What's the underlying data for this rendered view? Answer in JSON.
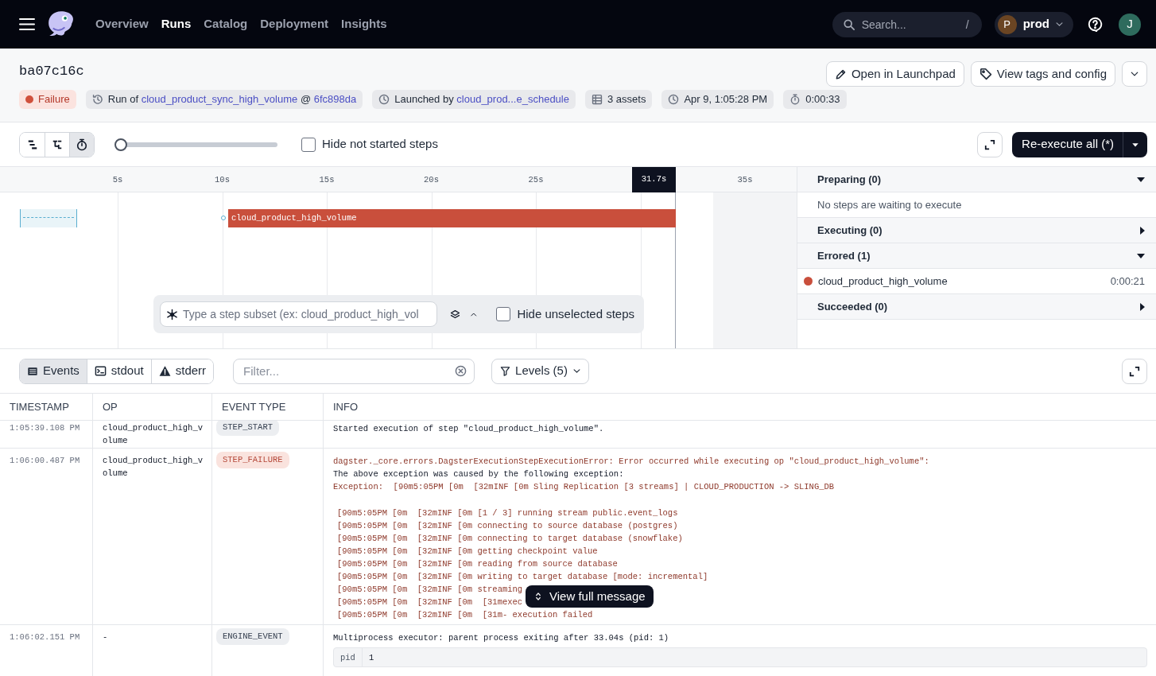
{
  "nav": {
    "links": [
      {
        "label": "Overview",
        "selected": false
      },
      {
        "label": "Runs",
        "selected": true
      },
      {
        "label": "Catalog",
        "selected": false
      },
      {
        "label": "Deployment",
        "selected": false
      },
      {
        "label": "Insights",
        "selected": false
      }
    ],
    "search": {
      "placeholder": "Search...",
      "shortcut": "/"
    },
    "deployment": {
      "initial": "P",
      "name": "prod"
    },
    "user": {
      "initial": "J"
    }
  },
  "run": {
    "title": "ba07c16c",
    "status": {
      "label": "Failure",
      "kind": "failure"
    },
    "tags": [
      {
        "kind": "job",
        "segments": [
          {
            "text": "Run of",
            "link": false
          },
          {
            "text": "cloud_product_sync_high_volume",
            "link": true
          },
          {
            "text": "@",
            "link": false
          },
          {
            "text": "6fc898da",
            "link": true
          }
        ]
      },
      {
        "kind": "launch",
        "segments": [
          {
            "text": "Launched by",
            "link": false
          },
          {
            "text": "cloud_prod...e_schedule",
            "link": true
          }
        ]
      },
      {
        "kind": "assets",
        "segments": [
          {
            "text": "3 assets",
            "link": false
          }
        ]
      },
      {
        "kind": "start",
        "segments": [
          {
            "text": "Apr 9, 1:05:28 PM",
            "link": false
          }
        ]
      },
      {
        "kind": "duration",
        "segments": [
          {
            "text": "0:00:33",
            "link": false
          }
        ]
      }
    ],
    "actions": [
      {
        "kind": "edit",
        "label": "Open in Launchpad"
      },
      {
        "kind": "tag",
        "label": "View tags and config"
      }
    ]
  },
  "toolbar": {
    "view_modes": [
      {
        "kind": "list",
        "selected": false
      },
      {
        "kind": "graph",
        "selected": false
      },
      {
        "kind": "timer",
        "selected": true
      }
    ],
    "zoom": {
      "level": 0
    },
    "hide_not_started": {
      "label": "Hide not started steps",
      "checked": false
    },
    "reexecute": {
      "label": "Re-execute all (*)"
    }
  },
  "timeline": {
    "ticks": [
      "5s",
      "10s",
      "15s",
      "20s",
      "25s",
      "35s"
    ],
    "current_time": "31.7s",
    "steps": [
      {
        "name": "cloud_product_high_volume",
        "color": "#c94f3c"
      }
    ],
    "step_subset": {
      "placeholder": "Type a step subset (ex: cloud_product_high_vol",
      "hide_unselected": {
        "label": "Hide unselected steps",
        "checked": false
      }
    }
  },
  "step_panel": {
    "sections": [
      {
        "title": "Preparing (0)",
        "expanded": true,
        "empty_text": "No steps are waiting to execute"
      },
      {
        "title": "Executing (0)",
        "expanded": false
      },
      {
        "title": "Errored (1)",
        "expanded": true,
        "steps": [
          {
            "name": "cloud_product_high_volume",
            "duration": "0:00:21",
            "color": "#c94f3c"
          }
        ]
      },
      {
        "title": "Succeeded (0)",
        "expanded": false
      }
    ]
  },
  "logs": {
    "tabs": [
      {
        "kind": "events",
        "label": "Events",
        "selected": true
      },
      {
        "kind": "stdout",
        "label": "stdout",
        "selected": false
      },
      {
        "kind": "stderr",
        "label": "stderr",
        "selected": false
      }
    ],
    "filter": {
      "placeholder": "Filter..."
    },
    "levels": {
      "label": "Levels (5)"
    },
    "table": {
      "columns": [
        "TIMESTAMP",
        "OP",
        "EVENT TYPE",
        "INFO"
      ],
      "rows": [
        {
          "timestamp": "1:05:39.108 PM",
          "op": "cloud_product_high_volume",
          "event_type": {
            "label": "STEP_START",
            "kind": "info"
          },
          "message": [
            {
              "text": "Started execution of step \"cloud_product_high_volume\".",
              "kind": "plain"
            }
          ]
        },
        {
          "timestamp": "1:06:00.487 PM",
          "op": "cloud_product_high_volume",
          "event_type": {
            "label": "STEP_FAILURE",
            "kind": "error"
          },
          "message": [
            {
              "text": "dagster._core.errors.DagsterExecutionStepExecutionError: Error occurred while executing op \"cloud_product_high_volume\":",
              "kind": "error"
            },
            {
              "text": "The above exception was caused by the following exception:",
              "kind": "plain"
            },
            {
              "text": "Exception:  [90m5:05PM [0m  [32mINF [0m Sling Replication [3 streams] | CLOUD_PRODUCTION -> SLING_DB",
              "kind": "error"
            }
          ],
          "output": [
            "[90m5:05PM [0m  [32mINF [0m [1 / 3] running stream public.event_logs",
            "[90m5:05PM [0m  [32mINF [0m connecting to source database (postgres)",
            "[90m5:05PM [0m  [32mINF [0m connecting to target database (snowflake)",
            "[90m5:05PM [0m  [32mINF [0m getting checkpoint value",
            "[90m5:05PM [0m  [32mINF [0m reading from source database",
            "[90m5:05PM [0m  [32mINF [0m writing to target database [mode: incremental]",
            "[90m5:05PM [0m  [32mINF [0m streaming",
            "[90m5:05PM [0m  [32mINF [0m  [31mexec",
            "[90m5:05PM [0m  [32mINF [0m  [31m- execution failed"
          ],
          "view_full": "View full message"
        },
        {
          "timestamp": "1:06:02.151 PM",
          "op": "-",
          "event_type": {
            "label": "ENGINE_EVENT",
            "kind": "info"
          },
          "message": [
            {
              "text": "Multiprocess executor: parent process exiting after 33.04s (pid: 1)",
              "kind": "plain"
            }
          ],
          "metadata": [
            {
              "key": "pid",
              "value": "1"
            }
          ]
        }
      ]
    }
  }
}
